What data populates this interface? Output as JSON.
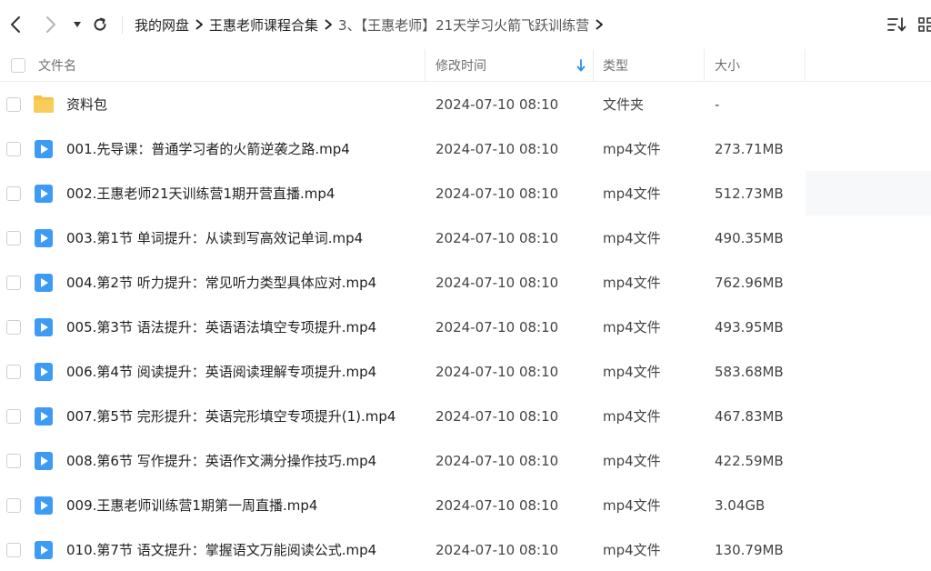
{
  "nav": {
    "back_icon": "chevron-left-icon",
    "forward_icon": "chevron-right-icon",
    "history_icon": "caret-down-icon",
    "refresh_icon": "refresh-icon"
  },
  "breadcrumb": [
    {
      "label": "我的网盘"
    },
    {
      "label": "王惠老师课程合集"
    },
    {
      "label": "3、【王惠老师】21天学习火箭飞跃训练营"
    }
  ],
  "toolbar": {
    "sort_icon": "sort-lines-icon",
    "view_icon": "grid-view-icon"
  },
  "columns": {
    "name": "文件名",
    "mtime": "修改时间",
    "type": "类型",
    "size": "大小",
    "sorted_by": "mtime",
    "sort_direction": "desc"
  },
  "files": [
    {
      "name": "资料包",
      "mtime": "2024-07-10 08:10",
      "type": "文件夹",
      "size": "-",
      "icon": "folder-icon"
    },
    {
      "name": "001.先导课：普通学习者的火箭逆袭之路.mp4",
      "mtime": "2024-07-10 08:10",
      "type": "mp4文件",
      "size": "273.71MB",
      "icon": "video-file-icon"
    },
    {
      "name": "002.王惠老师21天训练营1期开营直播.mp4",
      "mtime": "2024-07-10 08:10",
      "type": "mp4文件",
      "size": "512.73MB",
      "icon": "video-file-icon"
    },
    {
      "name": "003.第1节  单词提升：从读到写高效记单词.mp4",
      "mtime": "2024-07-10 08:10",
      "type": "mp4文件",
      "size": "490.35MB",
      "icon": "video-file-icon"
    },
    {
      "name": "004.第2节  听力提升：常见听力类型具体应对.mp4",
      "mtime": "2024-07-10 08:10",
      "type": "mp4文件",
      "size": "762.96MB",
      "icon": "video-file-icon"
    },
    {
      "name": "005.第3节  语法提升：英语语法填空专项提升.mp4",
      "mtime": "2024-07-10 08:10",
      "type": "mp4文件",
      "size": "493.95MB",
      "icon": "video-file-icon"
    },
    {
      "name": "006.第4节   阅读提升：英语阅读理解专项提升.mp4",
      "mtime": "2024-07-10 08:10",
      "type": "mp4文件",
      "size": "583.68MB",
      "icon": "video-file-icon"
    },
    {
      "name": "007.第5节  完形提升：英语完形填空专项提升(1).mp4",
      "mtime": "2024-07-10 08:10",
      "type": "mp4文件",
      "size": "467.83MB",
      "icon": "video-file-icon"
    },
    {
      "name": "008.第6节  写作提升：英语作文满分操作技巧.mp4",
      "mtime": "2024-07-10 08:10",
      "type": "mp4文件",
      "size": "422.59MB",
      "icon": "video-file-icon"
    },
    {
      "name": "009.王惠老师训练营1期第一周直播.mp4",
      "mtime": "2024-07-10 08:10",
      "type": "mp4文件",
      "size": "3.04GB",
      "icon": "video-file-icon"
    },
    {
      "name": "010.第7节   语文提升：掌握语文万能阅读公式.mp4",
      "mtime": "2024-07-10 08:10",
      "type": "mp4文件",
      "size": "130.79MB",
      "icon": "video-file-icon"
    }
  ],
  "colors": {
    "accent": "#2a8cf7",
    "folder": "#f7c046",
    "video_icon": "#3d9bf5",
    "header_text": "#6f6f6f"
  }
}
